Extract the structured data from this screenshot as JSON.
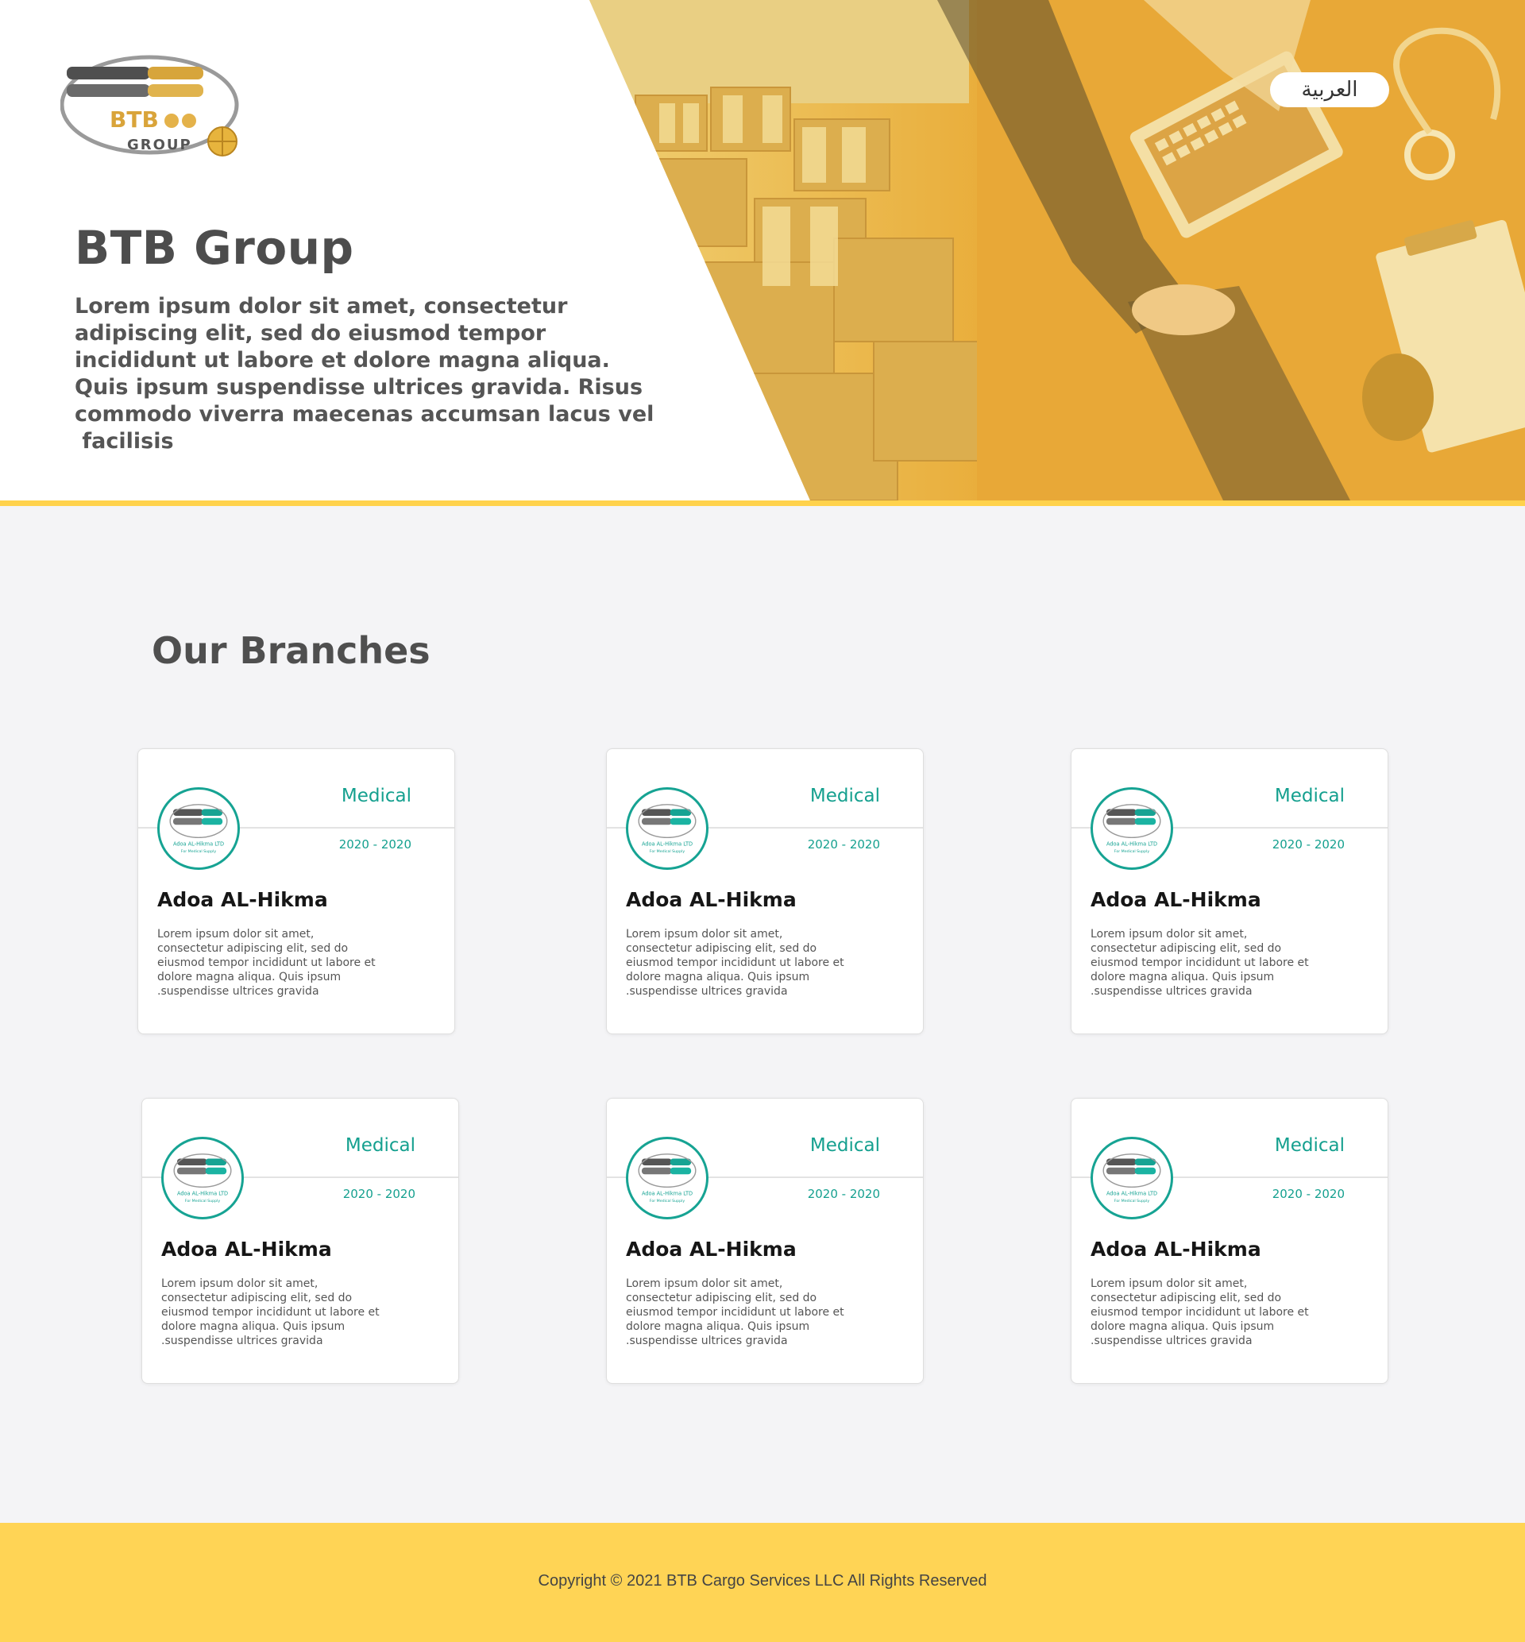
{
  "language_toggle": {
    "label": "العربية"
  },
  "logo": {
    "mark_text": "BTB",
    "group_text": "GROUP"
  },
  "hero": {
    "title": "BTB Group",
    "lines": [
      "Lorem ipsum dolor sit amet, consectetur",
      "adipiscing elit, sed do eiusmod tempor",
      "incididunt ut labore et dolore magna aliqua.",
      "Quis ipsum suspendisse ultrices gravida. Risus",
      "commodo viverra maecenas accumsan lacus vel",
      " facilisis"
    ]
  },
  "branches": {
    "title": "Our Branches",
    "items": [
      {
        "category": "Medical",
        "years": "2020 - 2020",
        "name": "Adoa AL-Hikma",
        "badge_lines": [
          "Adoa AL-Hikma LTD",
          "For Medical Supply"
        ],
        "desc": [
          "Lorem ipsum dolor sit amet,",
          "consectetur adipiscing elit, sed do",
          "eiusmod tempor incididunt ut labore et",
          "dolore magna aliqua. Quis ipsum",
          ".suspendisse ultrices gravida"
        ]
      },
      {
        "category": "Medical",
        "years": "2020 - 2020",
        "name": "Adoa AL-Hikma",
        "badge_lines": [
          "Adoa AL-Hikma LTD",
          "For Medical Supply"
        ],
        "desc": [
          "Lorem ipsum dolor sit amet,",
          "consectetur adipiscing elit, sed do",
          "eiusmod tempor incididunt ut labore et",
          "dolore magna aliqua. Quis ipsum",
          ".suspendisse ultrices gravida"
        ]
      },
      {
        "category": "Medical",
        "years": "2020 - 2020",
        "name": "Adoa AL-Hikma",
        "badge_lines": [
          "Adoa AL-Hikma LTD",
          "For Medical Supply"
        ],
        "desc": [
          "Lorem ipsum dolor sit amet,",
          "consectetur adipiscing elit, sed do",
          "eiusmod tempor incididunt ut labore et",
          "dolore magna aliqua. Quis ipsum",
          ".suspendisse ultrices gravida"
        ]
      },
      {
        "category": "Medical",
        "years": "2020 - 2020",
        "name": "Adoa AL-Hikma",
        "badge_lines": [
          "Adoa AL-Hikma LTD",
          "For Medical Supply"
        ],
        "desc": [
          "Lorem ipsum dolor sit amet,",
          "consectetur adipiscing elit, sed do",
          "eiusmod tempor incididunt ut labore et",
          "dolore magna aliqua. Quis ipsum",
          ".suspendisse ultrices gravida"
        ]
      },
      {
        "category": "Medical",
        "years": "2020 - 2020",
        "name": "Adoa AL-Hikma",
        "badge_lines": [
          "Adoa AL-Hikma LTD",
          "For Medical Supply"
        ],
        "desc": [
          "Lorem ipsum dolor sit amet,",
          "consectetur adipiscing elit, sed do",
          "eiusmod tempor incididunt ut labore et",
          "dolore magna aliqua. Quis ipsum",
          ".suspendisse ultrices gravida"
        ]
      },
      {
        "category": "Medical",
        "years": "2020 - 2020",
        "name": "Adoa AL-Hikma",
        "badge_lines": [
          "Adoa AL-Hikma LTD",
          "For Medical Supply"
        ],
        "desc": [
          "Lorem ipsum dolor sit amet,",
          "consectetur adipiscing elit, sed do",
          "eiusmod tempor incididunt ut labore et",
          "dolore magna aliqua. Quis ipsum",
          ".suspendisse ultrices gravida"
        ]
      }
    ]
  },
  "footer": {
    "copyright": "Copyright © 2021 BTB Cargo Services LLC All Rights Reserved"
  },
  "colors": {
    "accent_yellow": "#ffd24c",
    "teal": "#16a393",
    "footer_bg": "#ffd455",
    "text_dark": "#4d4d4d"
  }
}
